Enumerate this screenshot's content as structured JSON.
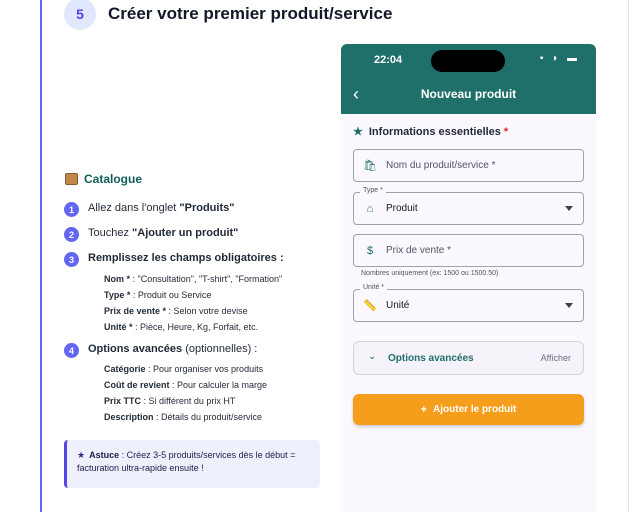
{
  "step": {
    "number": "5",
    "title": "Créer votre premier produit/service"
  },
  "instructions": {
    "category_label": "Catalogue",
    "steps": [
      {
        "num": "1",
        "pre": "Allez dans l'onglet ",
        "bold": "\"Produits\"",
        "post": ""
      },
      {
        "num": "2",
        "pre": "Touchez ",
        "bold": "\"Ajouter un produit\"",
        "post": ""
      },
      {
        "num": "3",
        "pre": "",
        "bold": "Remplissez les champs obligatoires :",
        "post": ""
      },
      {
        "num": "4",
        "pre": "",
        "bold": "Options avancées",
        "post": " (optionnelles) :"
      }
    ],
    "required_fields": [
      {
        "label": "Nom * ",
        "desc": ": \"Consultation\", \"T-shirt\", \"Formation\""
      },
      {
        "label": "Type * ",
        "desc": ": Produit ou Service"
      },
      {
        "label": "Prix de vente * ",
        "desc": ": Selon votre devise"
      },
      {
        "label": "Unité * ",
        "desc": ": Pièce, Heure, Kg, Forfait, etc."
      }
    ],
    "advanced_fields": [
      {
        "label": "Catégorie ",
        "desc": ": Pour organiser vos produits"
      },
      {
        "label": "Coût de revient ",
        "desc": ": Pour calculer la marge"
      },
      {
        "label": "Prix TTC ",
        "desc": ": Si différent du prix HT"
      },
      {
        "label": "Description ",
        "desc": ": Détails du produit/service"
      }
    ]
  },
  "tip": {
    "label": "Astuce",
    "text": " : Créez 3-5 produits/services dès le début = facturation ultra-rapide ensuite !"
  },
  "phone": {
    "time": "22:04",
    "title": "Nouveau produit",
    "section_title": "Informations essentielles",
    "section_required": "*",
    "name_placeholder": "Nom du produit/service *",
    "type_label": "Type *",
    "type_value": "Produit",
    "price_placeholder": "Prix de vente *",
    "price_helper": "Nombres uniquement (ex: 1500 ou 1500.50)",
    "unit_label": "Unité *",
    "unit_value": "Unité",
    "advanced_label": "Options avancées",
    "advanced_toggle": "Afficher",
    "add_button": "Ajouter le produit"
  },
  "colors": {
    "accent": "#6366f1",
    "teal": "#1f6f6b",
    "orange": "#f59e1b"
  }
}
